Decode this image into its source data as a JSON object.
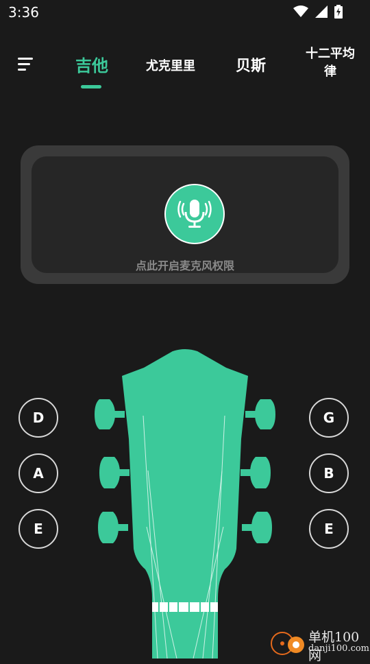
{
  "status": {
    "time": "3:36"
  },
  "tabs": {
    "guitar": "吉他",
    "ukulele": "尤克里里",
    "bass": "贝斯",
    "twelve_tet": "十二平均律"
  },
  "mic": {
    "prompt": "点此开启麦克风权限"
  },
  "strings": {
    "left": [
      "D",
      "A",
      "E"
    ],
    "right": [
      "G",
      "B",
      "E"
    ]
  },
  "colors": {
    "accent": "#3cc99a",
    "background": "#1a1a1a"
  },
  "watermark": {
    "name": "单机100网",
    "url": "danji100.com"
  }
}
